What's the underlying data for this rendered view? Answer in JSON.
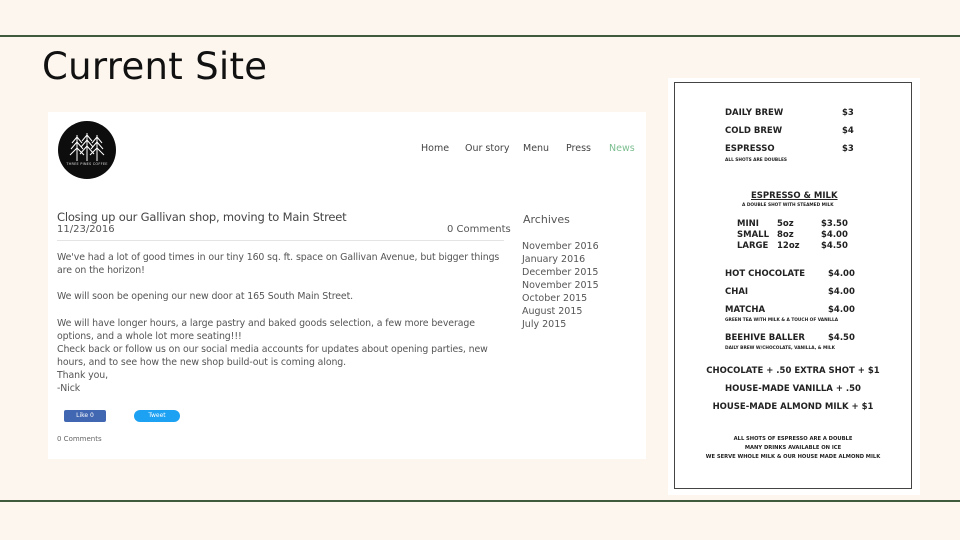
{
  "slide": {
    "title": "Current Site"
  },
  "site": {
    "logo_text": "THREE PINES COFFEE",
    "nav": [
      {
        "label": "Home"
      },
      {
        "label": "Our story"
      },
      {
        "label": "Menu"
      },
      {
        "label": "Press"
      },
      {
        "label": "News",
        "active": true
      }
    ],
    "post": {
      "title": "Closing up our Gallivan shop, moving to Main Street",
      "date": "11/23/2016",
      "comments": "0 Comments",
      "paragraphs": [
        "We've had a lot of good times in our tiny 160 sq. ft. space on Gallivan Avenue, but bigger things are on the horizon!",
        "We will soon be opening our new door at 165 South Main Street.",
        "We will have longer hours, a large pastry and baked goods selection, a few more beverage options, and a whole lot more seating!!!",
        "Check back or follow us on our social media accounts for updates about opening parties, new hours, and to see how the new shop build-out is coming along.",
        "Thank you,",
        "-Nick"
      ],
      "like_label": "Like 0",
      "tweet_label": "Tweet",
      "footer_comments": "0 Comments"
    },
    "archives": {
      "heading": "Archives",
      "items": [
        "November 2016",
        "January 2016",
        "December 2015",
        "November 2015",
        "October 2015",
        "August 2015",
        "July 2015"
      ]
    }
  },
  "menu_board": {
    "items": [
      {
        "name": "DAILY BREW",
        "price": "$3"
      },
      {
        "name": "COLD BREW",
        "price": "$4"
      },
      {
        "name": "ESPRESSO",
        "price": "$3"
      }
    ],
    "espresso_note": "ALL SHOTS ARE DOUBLES",
    "espresso_milk": {
      "title": "ESPRESSO & MILK",
      "subtitle": "A DOUBLE SHOT WITH STEAMED MILK",
      "sizes": [
        {
          "name": "MINI",
          "oz": "5oz",
          "price": "$3.50"
        },
        {
          "name": "SMALL",
          "oz": "8oz",
          "price": "$4.00"
        },
        {
          "name": "LARGE",
          "oz": "12oz",
          "price": "$4.50"
        }
      ]
    },
    "specialties": [
      {
        "name": "HOT CHOCOLATE",
        "price": "$4.00",
        "note": ""
      },
      {
        "name": "CHAI",
        "price": "$4.00",
        "note": ""
      },
      {
        "name": "MATCHA",
        "price": "$4.00",
        "note": "GREEN TEA WITH MILK & A TOUCH OF VANILLA"
      },
      {
        "name": "BEEHIVE BALLER",
        "price": "$4.50",
        "note": "DAILY BREW W/CHOCOLATE, VANILLA, & MILK"
      }
    ],
    "addons": [
      "CHOCOLATE  + .50    EXTRA SHOT  + $1",
      "HOUSE-MADE VANILLA + .50",
      "HOUSE-MADE ALMOND MILK + $1"
    ],
    "footer": [
      "ALL SHOTS OF ESPRESSO ARE A DOUBLE",
      "MANY DRINKS AVAILABLE ON ICE",
      "WE SERVE WHOLE MILK & OUR HOUSE MADE ALMOND MILK"
    ]
  }
}
